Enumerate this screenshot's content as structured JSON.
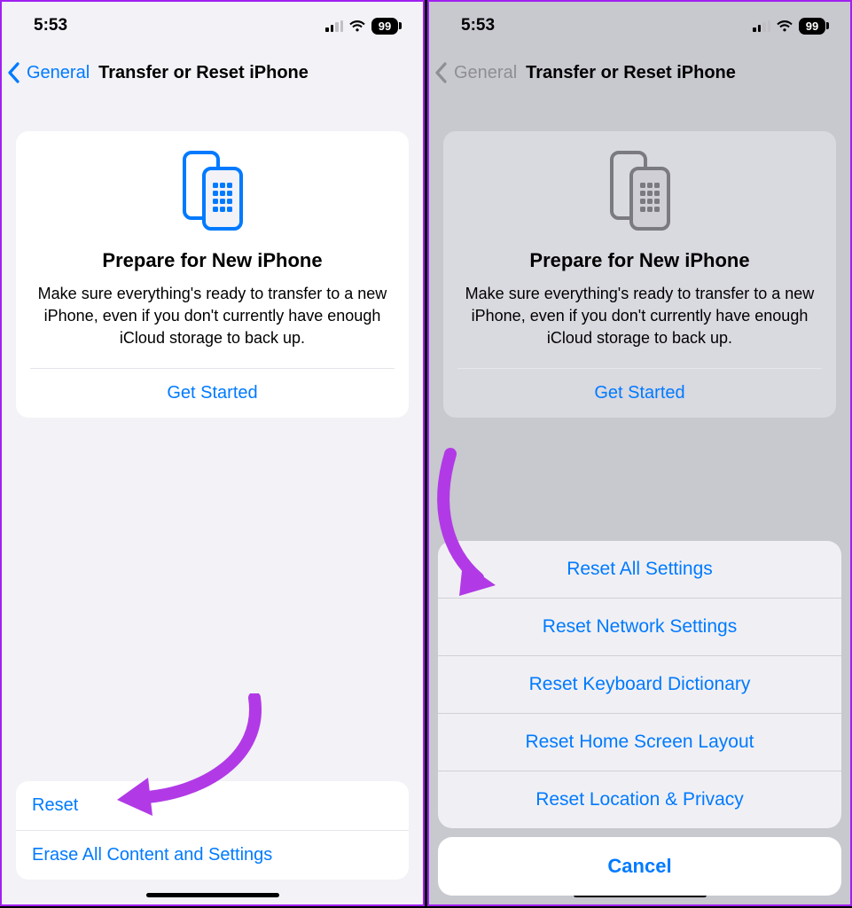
{
  "status_bar": {
    "time": "5:53",
    "battery_level": "99"
  },
  "nav": {
    "back_label": "General",
    "title": "Transfer or Reset iPhone"
  },
  "prepare_card": {
    "title": "Prepare for New iPhone",
    "body": "Make sure everything's ready to transfer to a new iPhone, even if you don't currently have enough iCloud storage to back up.",
    "action": "Get Started"
  },
  "bottom_list": {
    "reset": "Reset",
    "erase": "Erase All Content and Settings"
  },
  "action_sheet": {
    "items": [
      "Reset All Settings",
      "Reset Network Settings",
      "Reset Keyboard Dictionary",
      "Reset Home Screen Layout",
      "Reset Location & Privacy"
    ],
    "cancel": "Cancel"
  },
  "colors": {
    "accent": "#007aff",
    "arrow": "#b13ae6"
  }
}
